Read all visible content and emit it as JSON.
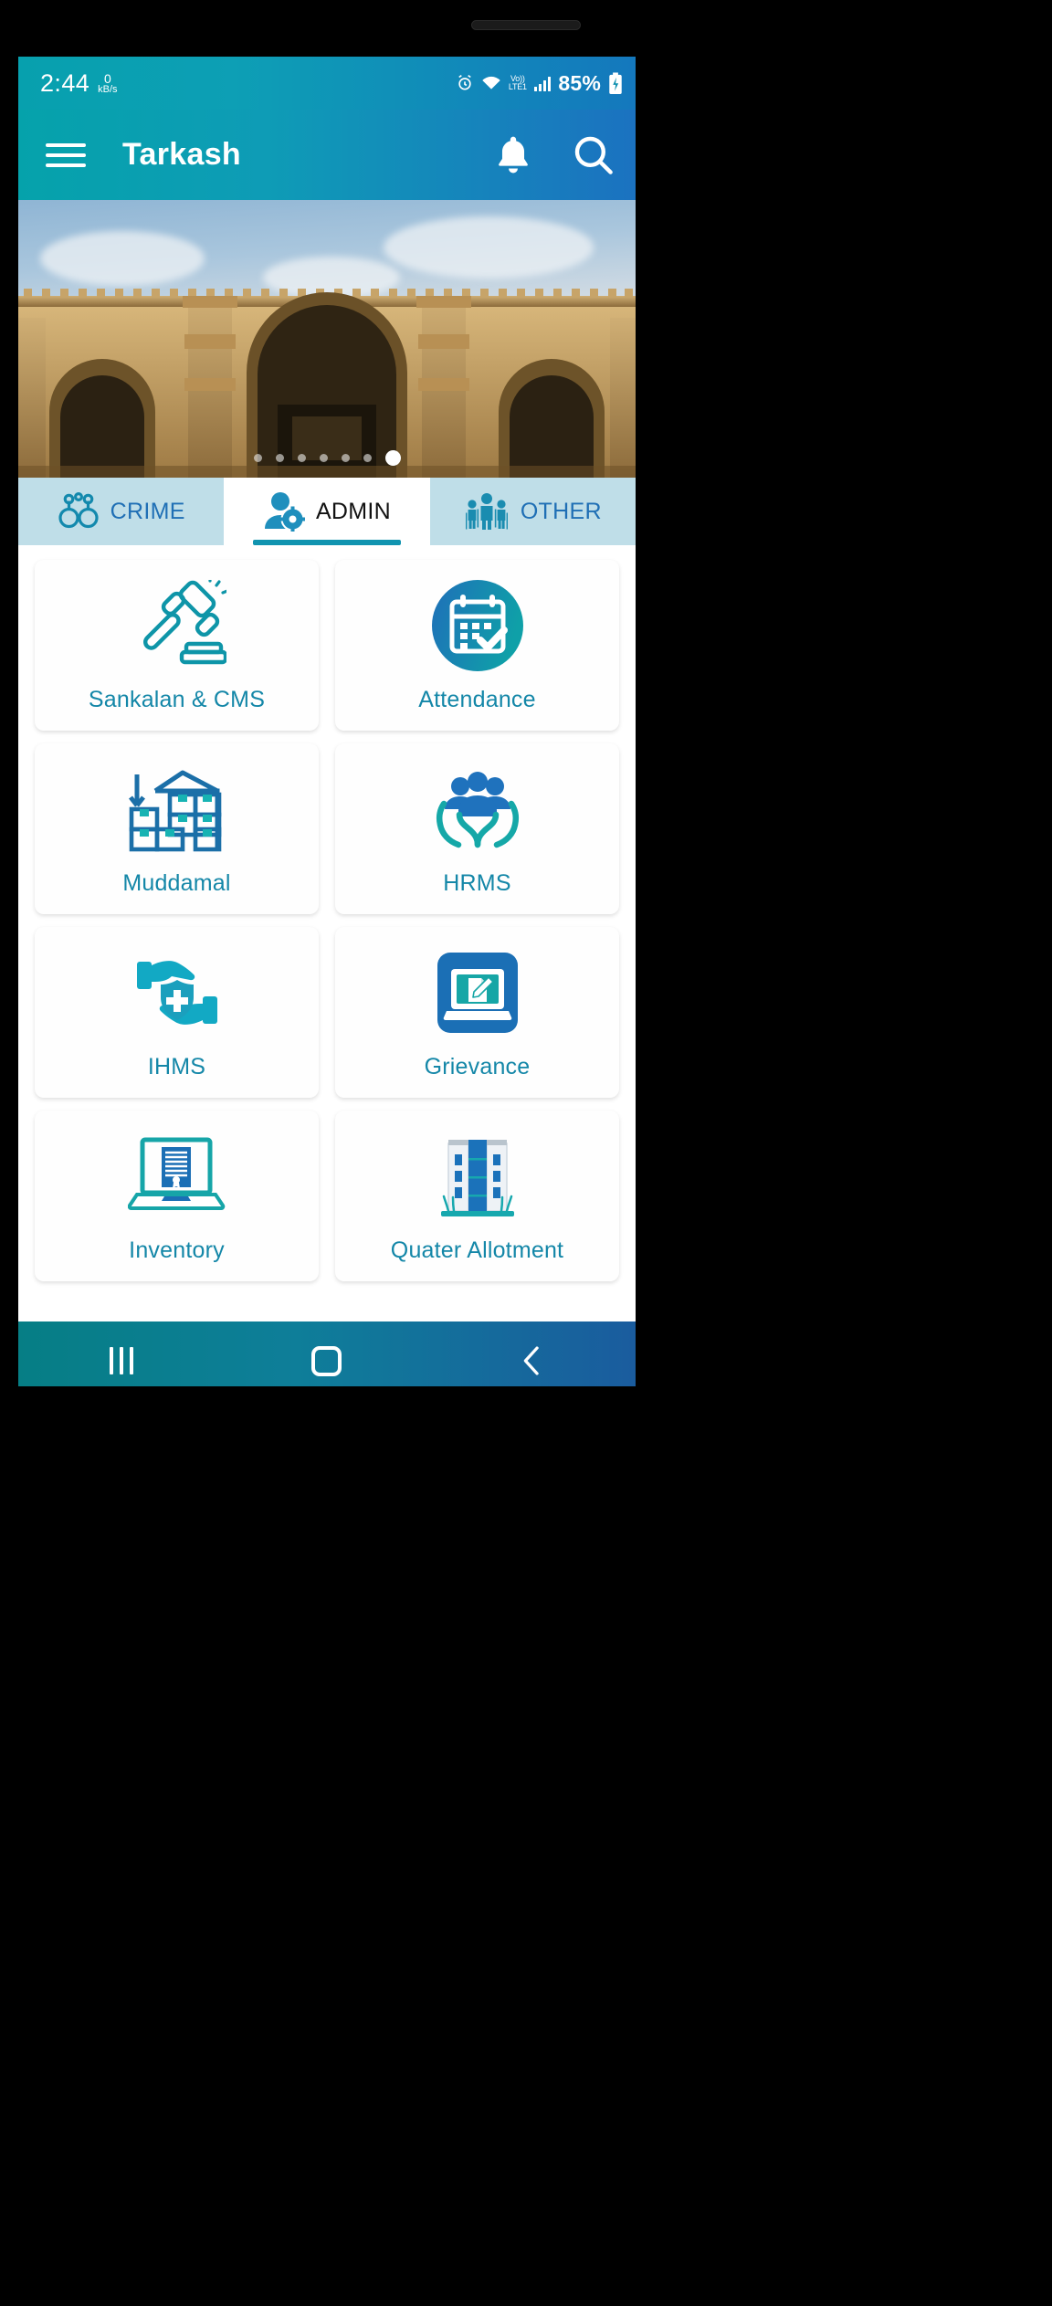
{
  "statusbar": {
    "time": "2:44",
    "net_speed_value": "0",
    "net_speed_unit": "kB/s",
    "volte_top": "Vo))",
    "volte_bottom": "LTE1",
    "battery_percent": "85%",
    "icons": [
      "alarm-icon",
      "wifi-icon",
      "volte-icon",
      "signal-bars-icon",
      "battery-icon"
    ]
  },
  "appbar": {
    "title": "Tarkash",
    "menu_icon": "hamburger-menu-icon",
    "notification_icon": "bell-icon",
    "search_icon": "search-icon"
  },
  "banner": {
    "alt": "Historic stone mosque with carved arches",
    "dot_count": 7,
    "active_dot_index": 6
  },
  "tabs": [
    {
      "label": "CRIME",
      "icon": "handcuffs-icon",
      "active": false
    },
    {
      "label": "ADMIN",
      "icon": "user-gear-icon",
      "active": true
    },
    {
      "label": "OTHER",
      "icon": "family-people-icon",
      "active": false
    }
  ],
  "grid": {
    "items": [
      {
        "label": "Sankalan & CMS",
        "icon": "gavel-icon"
      },
      {
        "label": "Attendance",
        "icon": "calendar-check-icon"
      },
      {
        "label": "Muddamal",
        "icon": "warehouse-boxes-icon"
      },
      {
        "label": "HRMS",
        "icon": "people-in-hands-icon"
      },
      {
        "label": "IHMS",
        "icon": "hands-health-shield-icon"
      },
      {
        "label": "Grievance",
        "icon": "laptop-document-pencil-icon"
      },
      {
        "label": "Inventory",
        "icon": "laptop-certificate-icon"
      },
      {
        "label": "Quater Allotment",
        "icon": "apartment-building-icon"
      }
    ]
  },
  "navbar": {
    "recents_label": "recents-button",
    "home_label": "home-button",
    "back_label": "back-button"
  },
  "colors": {
    "accent_teal": "#1194b0",
    "accent_blue": "#1f6fb5",
    "tab_inactive_bg": "#bfdee8",
    "label_teal": "#1487a8"
  }
}
